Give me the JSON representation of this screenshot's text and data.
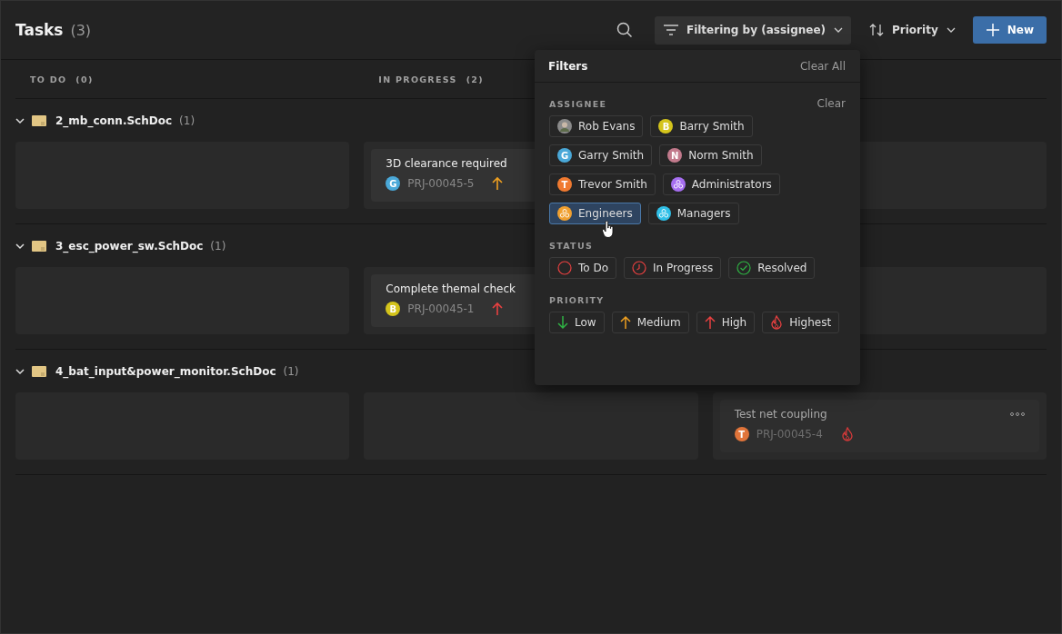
{
  "header": {
    "title": "Tasks",
    "count": "(3)",
    "filter_label": "Filtering by (assignee)",
    "sort_label": "Priority",
    "new_label": "New"
  },
  "columns": [
    {
      "title": "TO DO",
      "count": "(0)"
    },
    {
      "title": "IN PROGRESS",
      "count": "(2)"
    },
    {}
  ],
  "groups": [
    {
      "name": "2_mb_conn.SchDoc",
      "count": "(1)",
      "expanded": true,
      "cells": [
        [],
        [
          {
            "title": "3D clearance required",
            "avatar": "G",
            "color": "#4aa8d8",
            "id": "PRJ-00045-5",
            "kind": "medium",
            "faded": false
          }
        ],
        []
      ]
    },
    {
      "name": "3_esc_power_sw.SchDoc",
      "count": "(1)",
      "expanded": true,
      "cells": [
        [],
        [
          {
            "title": "Complete themal check",
            "avatar": "B",
            "color": "#d4c41c",
            "id": "PRJ-00045-1",
            "kind": "high",
            "faded": false
          }
        ],
        []
      ]
    },
    {
      "name": "4_bat_input&power_monitor.SchDoc",
      "count": "(1)",
      "expanded": true,
      "cells": [
        [],
        [],
        [
          {
            "title": "Test net coupling",
            "avatar": "T",
            "color": "#e0743a",
            "id": "PRJ-00045-4",
            "kind": "highest",
            "faded": true
          }
        ]
      ]
    }
  ],
  "filters": {
    "title": "Filters",
    "clear_all": "Clear All",
    "sections": [
      {
        "title": "ASSIGNEE",
        "clear": "Clear",
        "chips": [
          {
            "kind": "photo",
            "label": "Rob Evans",
            "selected": false
          },
          {
            "kind": "letter",
            "letter": "B",
            "color": "#d4c41c",
            "label": "Barry Smith",
            "selected": false
          },
          {
            "kind": "letter",
            "letter": "G",
            "color": "#4aa8d8",
            "label": "Garry Smith",
            "selected": false
          },
          {
            "kind": "letter",
            "letter": "N",
            "color": "#c27a8c",
            "label": "Norm Smith",
            "selected": false
          },
          {
            "kind": "letter",
            "letter": "T",
            "color": "#f07a30",
            "label": "Trevor Smith",
            "selected": false
          },
          {
            "kind": "group",
            "color": "#a66ef0",
            "label": "Administrators",
            "selected": false
          },
          {
            "kind": "group",
            "color": "#f0a030",
            "label": "Engineers",
            "selected": true
          },
          {
            "kind": "group",
            "color": "#30c0e8",
            "label": "Managers",
            "selected": false
          }
        ]
      },
      {
        "title": "STATUS",
        "chips": [
          {
            "kind": "todo",
            "label": "To Do",
            "selected": false
          },
          {
            "kind": "in_progress",
            "label": "In Progress",
            "selected": false
          },
          {
            "kind": "resolved",
            "label": "Resolved",
            "selected": false
          }
        ]
      },
      {
        "title": "PRIORITY",
        "chips": [
          {
            "kind": "low",
            "label": "Low",
            "selected": false
          },
          {
            "kind": "medium",
            "label": "Medium",
            "selected": false
          },
          {
            "kind": "high",
            "label": "High",
            "selected": false
          },
          {
            "kind": "highest",
            "label": "Highest",
            "selected": false
          }
        ]
      }
    ]
  }
}
